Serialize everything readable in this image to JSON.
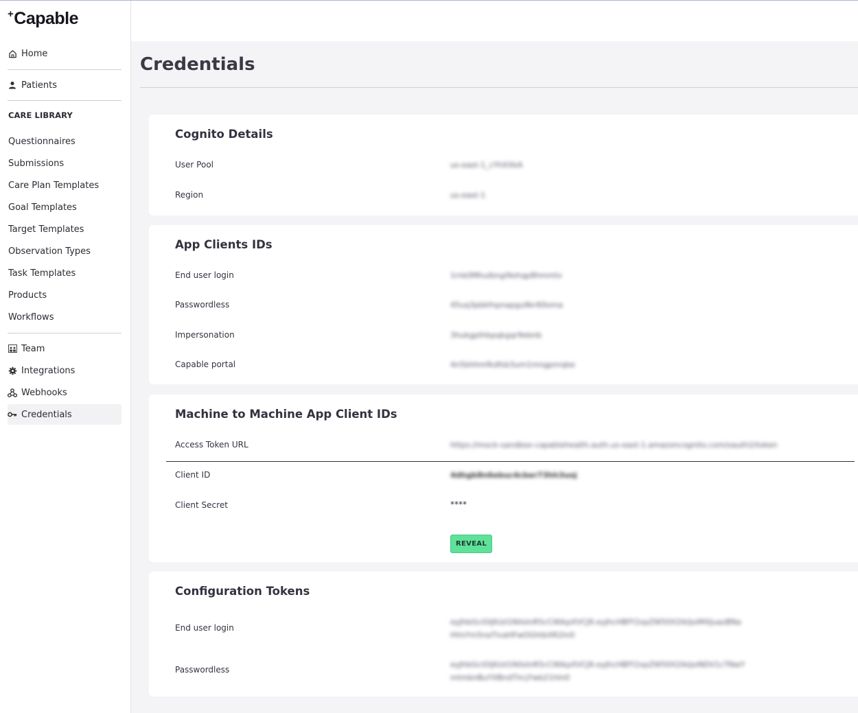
{
  "app": {
    "logo": "Capable"
  },
  "sidebar": {
    "top_items": [
      {
        "label": "Home",
        "icon": "home-icon"
      },
      {
        "label": "Patients",
        "icon": "person-icon"
      }
    ],
    "section_label": "CARE LIBRARY",
    "library_items": [
      "Questionnaires",
      "Submissions",
      "Care Plan Templates",
      "Goal Templates",
      "Target Templates",
      "Observation Types",
      "Task Templates",
      "Products",
      "Workflows"
    ],
    "bottom_items": [
      {
        "label": "Team",
        "icon": "team-icon"
      },
      {
        "label": "Integrations",
        "icon": "gear-icon"
      },
      {
        "label": "Webhooks",
        "icon": "webhook-icon"
      },
      {
        "label": "Credentials",
        "icon": "key-icon",
        "active": true
      }
    ]
  },
  "page": {
    "title": "Credentials"
  },
  "cognito": {
    "title": "Cognito Details",
    "rows": [
      {
        "label": "User Pool",
        "value": "us-east-1_cYhXXkA"
      },
      {
        "label": "Region",
        "value": "us-east-1"
      }
    ]
  },
  "app_clients": {
    "title": "App Clients IDs",
    "rows": [
      {
        "label": "End user login",
        "value": "1rnk0Mhulbngi9ohqp8hmmtv"
      },
      {
        "label": "Passwordless",
        "value": "45uq3pbkfnpnapgu9kr60oma"
      },
      {
        "label": "Impersonation",
        "value": "3hukgpthbpqkgqr9ebnb"
      },
      {
        "label": "Capable portal",
        "value": "4n5bhhmfkdfsb3um1mngpnrqbe"
      }
    ]
  },
  "m2m": {
    "title": "Machine to Machine App Client IDs",
    "rows": [
      {
        "label": "Access Token URL",
        "value": "https://mock-sandbox-capablehealth.auth.us-east-1.amazoncognito.com/oauth2/token"
      },
      {
        "label": "Client ID",
        "value": "4dhgb8n6ebuc4cber73hh3uoj"
      },
      {
        "label": "Client Secret",
        "value": "****"
      }
    ],
    "reveal_label": "REVEAL"
  },
  "config_tokens": {
    "title": "Configuration Tokens",
    "rows": [
      {
        "label": "End user login",
        "value": "eyJhbGciOiJIUzI1NiIsInR5cCI6IkpXVCJ9.eyJhcHBfY2xpZW50X2lkIjoiMXJuazBNaHVsYm5naTlvaHFwOGhtbXR2In0"
      },
      {
        "label": "Passwordless",
        "value": "eyJhbGciOiJIUzI1NiIsInR5cCI6IkpXVCJ9.eyJhcHBfY2xpZW50X2lkIjoiNDV1cTNwYmtmbnBuYXBndTlrcjYwb21hIn0"
      }
    ]
  }
}
